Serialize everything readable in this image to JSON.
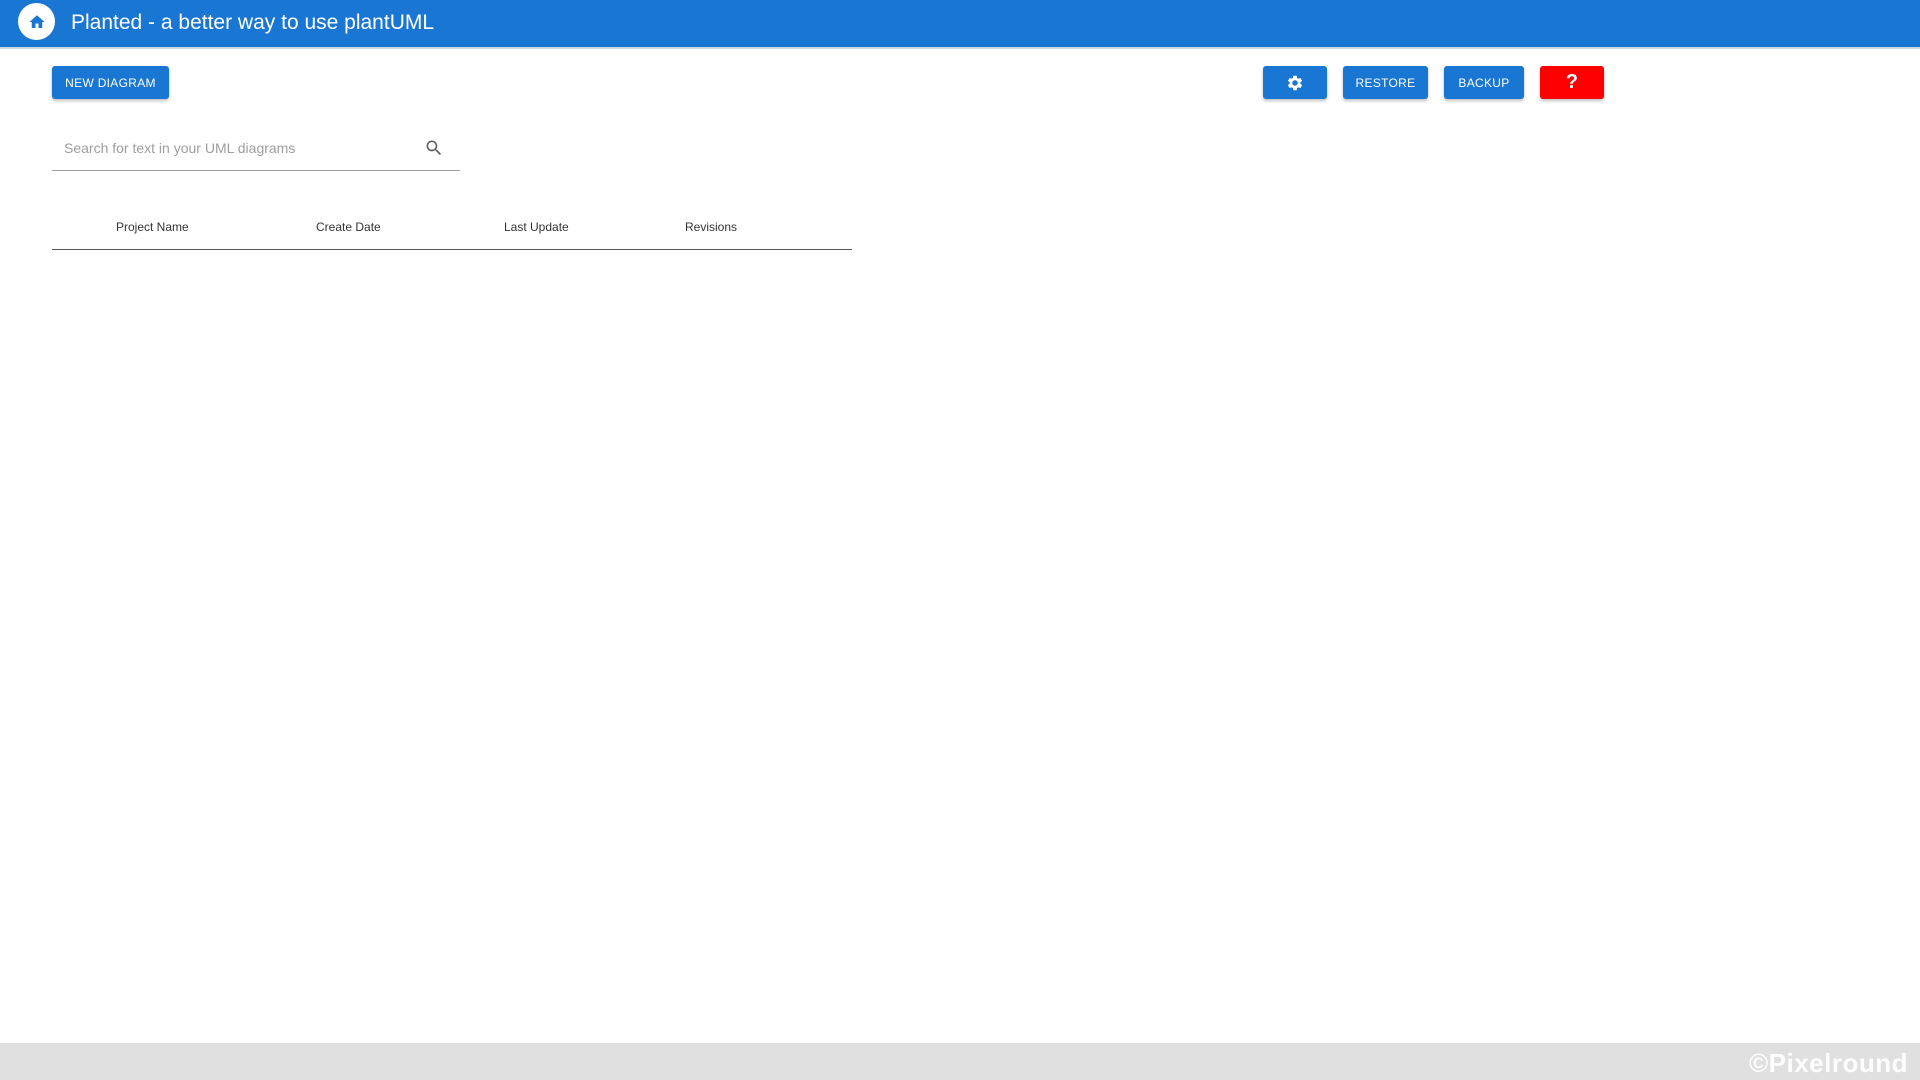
{
  "app_bar": {
    "title": "Planted - a better way to use plantUML",
    "home_icon": "home-icon",
    "color": "#1976d2"
  },
  "toolbar": {
    "new_diagram_label": "NEW DIAGRAM",
    "settings_icon": "gear-icon",
    "restore_label": "RESTORE",
    "backup_label": "BACKUP",
    "help_label": "?",
    "help_color": "#ff0000"
  },
  "search": {
    "placeholder": "Search for text in your UML diagrams",
    "value": "",
    "icon": "search-icon"
  },
  "table": {
    "columns": [
      "Project Name",
      "Create Date",
      "Last Update",
      "Revisions"
    ],
    "rows": []
  },
  "footer": {
    "watermark": "©Pixelround"
  }
}
